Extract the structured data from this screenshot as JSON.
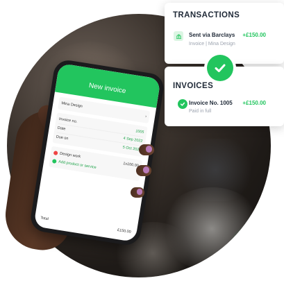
{
  "transactions_card": {
    "title": "TRANSACTIONS",
    "entry": {
      "title": "Sent via Barclays",
      "amount": "+£150.00",
      "subtitle": "Invoice | Mina Design",
      "icon": "bank-icon"
    }
  },
  "invoices_card": {
    "title": "INVOICES",
    "entry": {
      "title": "Invoice No. 1005",
      "amount": "+£150.00",
      "subtitle": "Paid in full",
      "icon": "check-circle-icon"
    }
  },
  "connector_icon": "checkmark-icon",
  "phone": {
    "header_title": "New invoice",
    "client": "Mina Design",
    "rows": [
      {
        "label": "Invoice no.",
        "value": "1005"
      },
      {
        "label": "Date",
        "value": "4 Sep 2022"
      },
      {
        "label": "Due on",
        "value": "5 Oct 2022"
      }
    ],
    "item": {
      "label": "Design work",
      "value": "1x100.00"
    },
    "add_label": "Add product or service",
    "total_label": "Total",
    "total_value": "£150.00"
  },
  "colors": {
    "accent_green": "#22c55e",
    "text_dark": "#1f2937",
    "text_muted": "#9ca3af"
  }
}
